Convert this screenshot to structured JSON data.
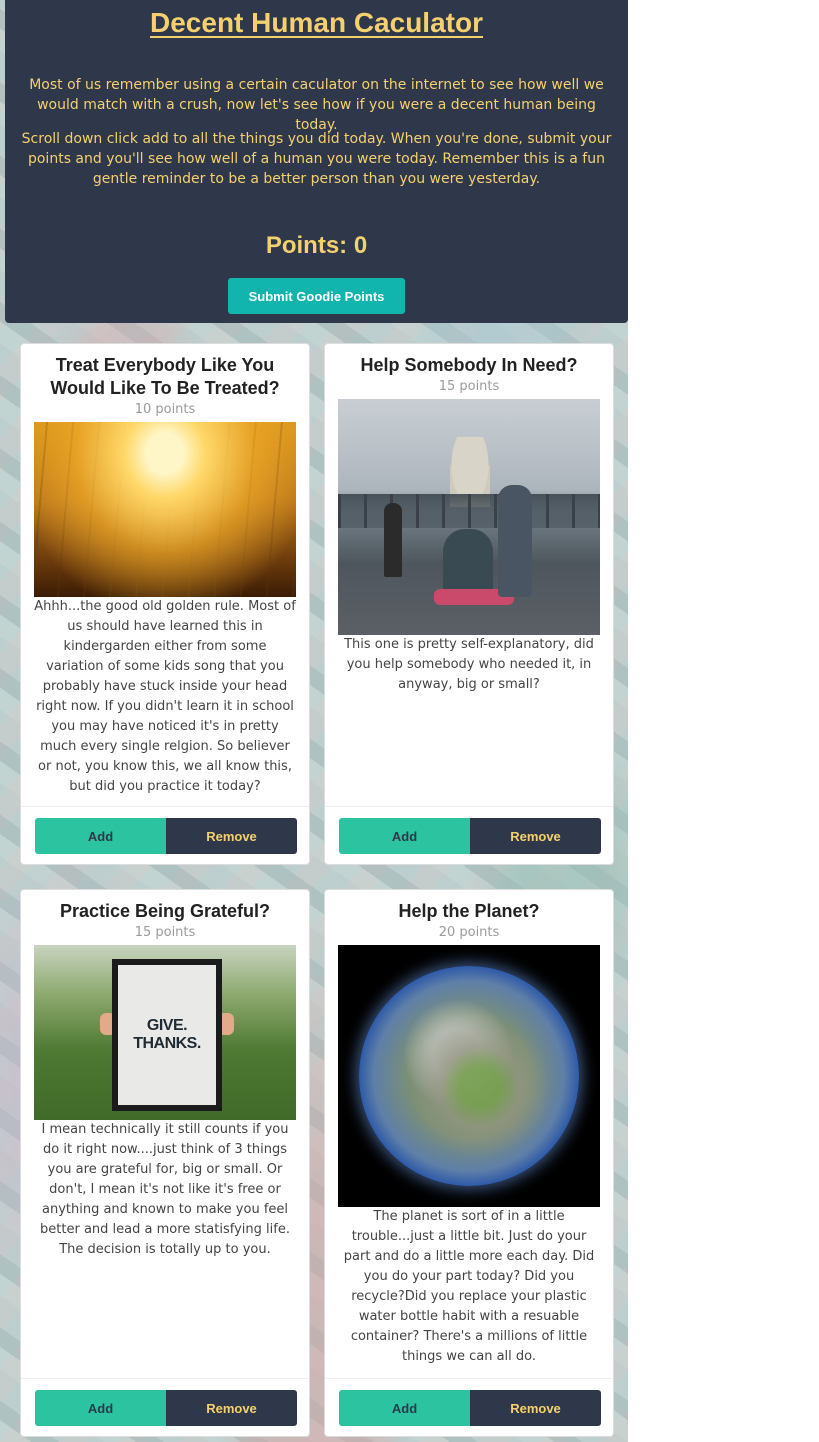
{
  "header": {
    "title": "Decent Human Caculator",
    "intro_1": "Most of us remember using a certain caculator on the internet to see how well we would match with a crush, now let's see how if you were a decent human being today.",
    "intro_2": "Scroll down click add to all the things you did today. When you're done, submit your points and you'll see how well of a human you were today. Remember this is a fun gentle reminder to be a better person than you were yesterday.",
    "points_label": "Points: 0",
    "submit_label": "Submit Goodie Points"
  },
  "cards": [
    {
      "title": "Treat Everybody Like You Would Like To Be Treated?",
      "points": "10 points",
      "image": "golden-grass-photo",
      "description": "Ahhh...the good old golden rule. Most of us should have learned this in kindergarden either from some variation of some kids song that you probably have stuck inside your head right now. If you didn't learn it in school you may have noticed it's in pretty much every single relgion. So believer or not, you know this, we all know this, but did you practice it today?",
      "add_label": "Add",
      "remove_label": "Remove"
    },
    {
      "title": "Help Somebody In Need?",
      "points": "15 points",
      "image": "helping-person-bridge-photo",
      "description": "This one is pretty self-explanatory, did you help somebody who needed it, in anyway, big or small?",
      "add_label": "Add",
      "remove_label": "Remove"
    },
    {
      "title": "Practice Being Grateful?",
      "points": "15 points",
      "image": "give-thanks-sign-photo",
      "image_text": "GIVE. THANKS.",
      "description": "I mean technically it still counts if you do it right now....just think of 3 things you are grateful for, big or small. Or don't, I mean it's not like it's free or anything and known to make you feel better and lead a more statisfying life. The decision is totally up to you.",
      "add_label": "Add",
      "remove_label": "Remove"
    },
    {
      "title": "Help the Planet?",
      "points": "20 points",
      "image": "planet-earth-photo",
      "description": "The planet is sort of in a little trouble...just a little bit. Just do your part and do a little more each day. Did you do your part today? Did you recycle?Did you replace your plastic water bottle habit with a resuable container? There's a millions of little things we can all do.",
      "add_label": "Add",
      "remove_label": "Remove"
    }
  ],
  "colors": {
    "header_bg": "#2f374a",
    "accent_yellow": "#f4d06f",
    "submit_teal": "#12b5ad",
    "add_green": "#2cc4a0",
    "remove_navy": "#2f374a"
  }
}
